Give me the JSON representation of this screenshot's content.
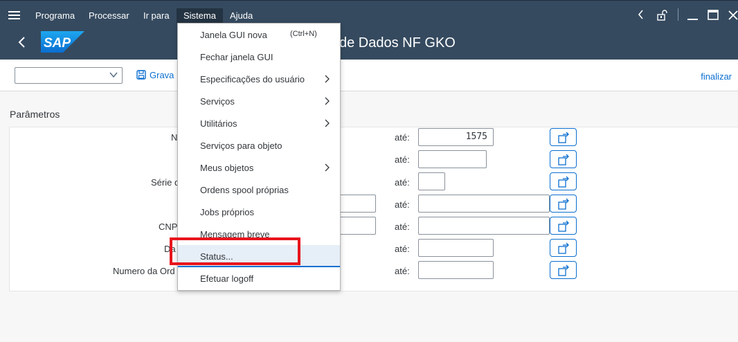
{
  "menubar": {
    "items": [
      "Programa",
      "Processar",
      "Ir para",
      "Sistema",
      "Ajuda"
    ],
    "active": "Sistema"
  },
  "title": "de Dados NF GKO",
  "toolbar": {
    "save_label": "Grava",
    "exit_label": "finalizar",
    "variant_value": ""
  },
  "section_title": "Parâmetros",
  "params": [
    {
      "label": "N",
      "ate": "até:",
      "to_value": "1575"
    },
    {
      "label": "",
      "ate": "até:",
      "to_value": ""
    },
    {
      "label": "Série d",
      "ate": "até:",
      "to_value": ""
    },
    {
      "label": "",
      "ate": "até:",
      "to_value": ""
    },
    {
      "label": "CNP",
      "ate": "até:",
      "to_value": ""
    },
    {
      "label": "Da",
      "ate": "até:",
      "to_value": ""
    },
    {
      "label": "Numero da Ord",
      "ate": "até:",
      "to_value": ""
    }
  ],
  "dropdown": {
    "items": [
      {
        "label": "Janela GUI nova",
        "shortcut": "(Ctrl+N)",
        "submenu": false
      },
      {
        "label": "Fechar janela GUI",
        "shortcut": "",
        "submenu": false
      },
      {
        "label": "Especificações do usuário",
        "shortcut": "",
        "submenu": true
      },
      {
        "label": "Serviços",
        "shortcut": "",
        "submenu": true
      },
      {
        "label": "Utilitários",
        "shortcut": "",
        "submenu": true
      },
      {
        "label": "Serviços para objeto",
        "shortcut": "",
        "submenu": false
      },
      {
        "label": "Meus objetos",
        "shortcut": "",
        "submenu": true
      },
      {
        "label": "Ordens spool próprias",
        "shortcut": "",
        "submenu": false
      },
      {
        "label": "Jobs próprios",
        "shortcut": "",
        "submenu": false
      },
      {
        "label": "Mensagem breve",
        "shortcut": "",
        "submenu": false
      },
      {
        "label": "Status...",
        "shortcut": "",
        "submenu": false
      },
      {
        "label": "Efetuar logoff",
        "shortcut": "",
        "submenu": false
      }
    ],
    "highlighted": "Status..."
  },
  "colors": {
    "shell": "#354a5f",
    "accent": "#0a6ed1",
    "highlight_box": "#e8141c"
  },
  "icons": [
    "menu-icon",
    "back-icon",
    "sap-logo",
    "save-icon",
    "chevron-down-icon",
    "multiple-selection-icon",
    "chevron-right-icon",
    "lock-icon",
    "minimize-icon",
    "maximize-icon",
    "close-icon"
  ]
}
